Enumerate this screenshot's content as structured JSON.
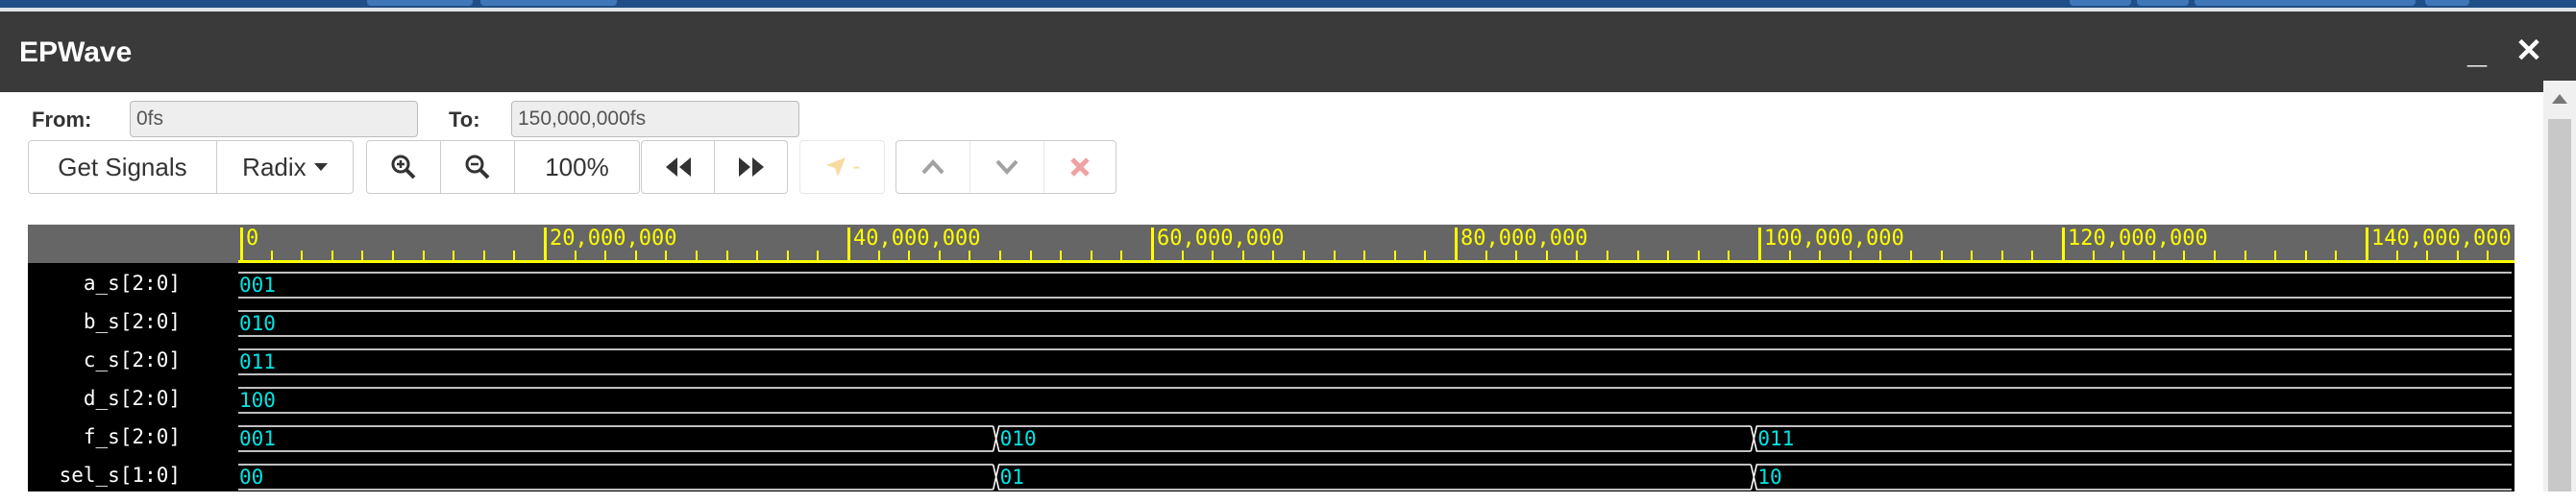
{
  "window": {
    "title": "EPWave"
  },
  "range": {
    "from_label": "From:",
    "from_value": "0fs",
    "to_label": "To:",
    "to_value": "150,000,000fs"
  },
  "toolbar": {
    "get_signals": "Get Signals",
    "radix": "Radix",
    "zoom_level": "100%",
    "cursor_marker": "-"
  },
  "ruler": {
    "ticks": [
      "0",
      "20,000,000",
      "40,000,000",
      "60,000,000",
      "80,000,000",
      "100,000,000",
      "120,000,000",
      "140,000,000"
    ]
  },
  "signals": [
    {
      "name": "a_s[2:0]",
      "segments": [
        {
          "start": 0,
          "value": "001"
        }
      ]
    },
    {
      "name": "b_s[2:0]",
      "segments": [
        {
          "start": 0,
          "value": "010"
        }
      ]
    },
    {
      "name": "c_s[2:0]",
      "segments": [
        {
          "start": 0,
          "value": "011"
        }
      ]
    },
    {
      "name": "d_s[2:0]",
      "segments": [
        {
          "start": 0,
          "value": "100"
        }
      ]
    },
    {
      "name": "f_s[2:0]",
      "segments": [
        {
          "start": 0,
          "value": "001"
        },
        {
          "start": 50000000,
          "value": "010"
        },
        {
          "start": 100000000,
          "value": "011"
        }
      ]
    },
    {
      "name": "sel_s[1:0]",
      "segments": [
        {
          "start": 0,
          "value": "00"
        },
        {
          "start": 50000000,
          "value": "01"
        },
        {
          "start": 100000000,
          "value": "10"
        }
      ]
    }
  ],
  "time_range": {
    "start": 0,
    "end": 150000000
  },
  "colors": {
    "value_text": "#00e5e5",
    "ruler": "#ffff00",
    "title_bar": "#3a3a3a",
    "delete": "#e03030",
    "marker": "#f0b030"
  }
}
